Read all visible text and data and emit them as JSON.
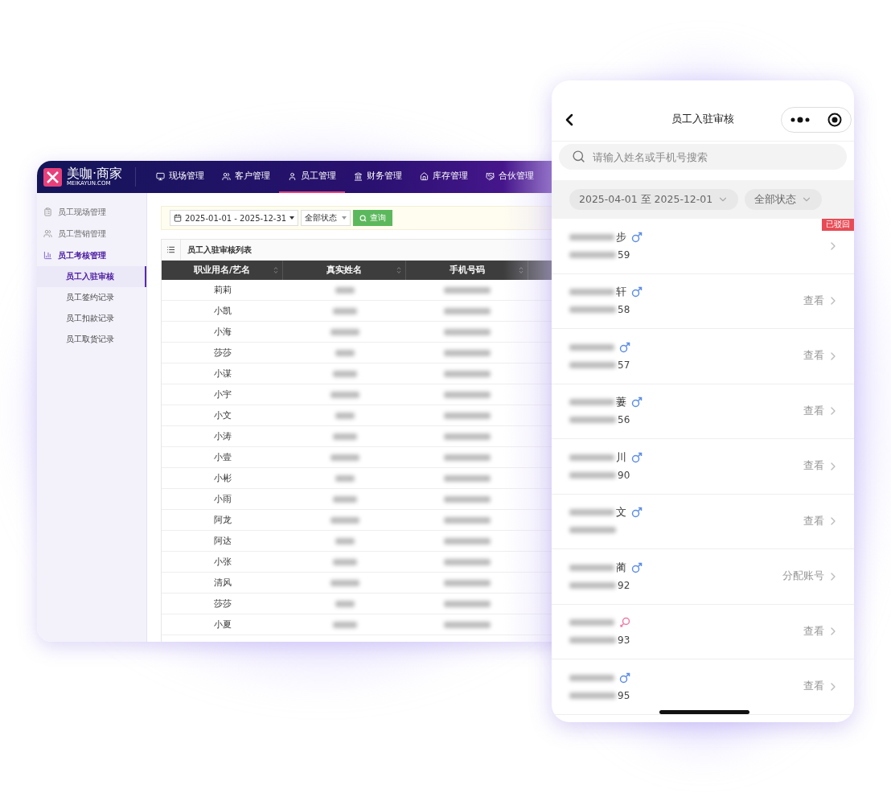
{
  "desktop": {
    "logo": {
      "brand": "美咖·商家",
      "domain": "MEIKAYUN.COM"
    },
    "nav": [
      {
        "label": "现场管理",
        "selected": false
      },
      {
        "label": "客户管理",
        "selected": false
      },
      {
        "label": "员工管理",
        "selected": true
      },
      {
        "label": "财务管理",
        "selected": false
      },
      {
        "label": "库存管理",
        "selected": false
      },
      {
        "label": "合伙管理",
        "selected": false
      }
    ],
    "sidebar": {
      "items": [
        {
          "label": "员工现场管理",
          "expanded": false
        },
        {
          "label": "员工营销管理",
          "expanded": false
        },
        {
          "label": "员工考核管理",
          "expanded": true,
          "children": [
            {
              "label": "员工入驻审核",
              "selected": true
            },
            {
              "label": "员工签约记录",
              "selected": false
            },
            {
              "label": "员工扣款记录",
              "selected": false
            },
            {
              "label": "员工取货记录",
              "selected": false
            }
          ]
        }
      ]
    },
    "filter": {
      "date_range": "2025-01-01 - 2025-12-31",
      "status": "全部状态",
      "query_button": "查询"
    },
    "panel_title": "员工入驻审核列表",
    "table": {
      "columns": [
        "职业用名/艺名",
        "真实姓名",
        "手机号码"
      ],
      "rows": [
        {
          "stage_name": "莉莉"
        },
        {
          "stage_name": "小凯"
        },
        {
          "stage_name": "小海"
        },
        {
          "stage_name": "莎莎"
        },
        {
          "stage_name": "小谋"
        },
        {
          "stage_name": "小宇"
        },
        {
          "stage_name": "小文"
        },
        {
          "stage_name": "小涛"
        },
        {
          "stage_name": "小壹"
        },
        {
          "stage_name": "小彬"
        },
        {
          "stage_name": "小雨"
        },
        {
          "stage_name": "阿龙"
        },
        {
          "stage_name": "阿达"
        },
        {
          "stage_name": "小张"
        },
        {
          "stage_name": "清风"
        },
        {
          "stage_name": "莎莎"
        },
        {
          "stage_name": "小夏"
        }
      ]
    }
  },
  "phone": {
    "title": "员工入驻审核",
    "search": {
      "placeholder": "请输入姓名或手机号搜索"
    },
    "filters": [
      {
        "label": "2025-04-01 至 2025-12-01"
      },
      {
        "label": "全部状态"
      }
    ],
    "list": [
      {
        "name_tail": "步",
        "phone_tail": "59",
        "kind": "male",
        "badge": "已驳回"
      },
      {
        "name_tail": "轩",
        "phone_tail": "58",
        "kind": "male",
        "action": "查看"
      },
      {
        "phone_tail": "57",
        "kind": "male",
        "action": "查看"
      },
      {
        "name_tail": "萋",
        "phone_tail": "56",
        "kind": "male",
        "action": "查看"
      },
      {
        "name_tail": "川",
        "phone_tail": "90",
        "kind": "male",
        "action": "查看"
      },
      {
        "name_tail": "文",
        "kind": "male",
        "action": "查看"
      },
      {
        "name_tail": "蔺",
        "phone_tail": "92",
        "kind": "male",
        "action": "分配账号"
      },
      {
        "phone_tail": "93",
        "kind": "female",
        "action": "查看"
      },
      {
        "phone_tail": "95",
        "kind": "male",
        "action": "查看"
      }
    ]
  }
}
